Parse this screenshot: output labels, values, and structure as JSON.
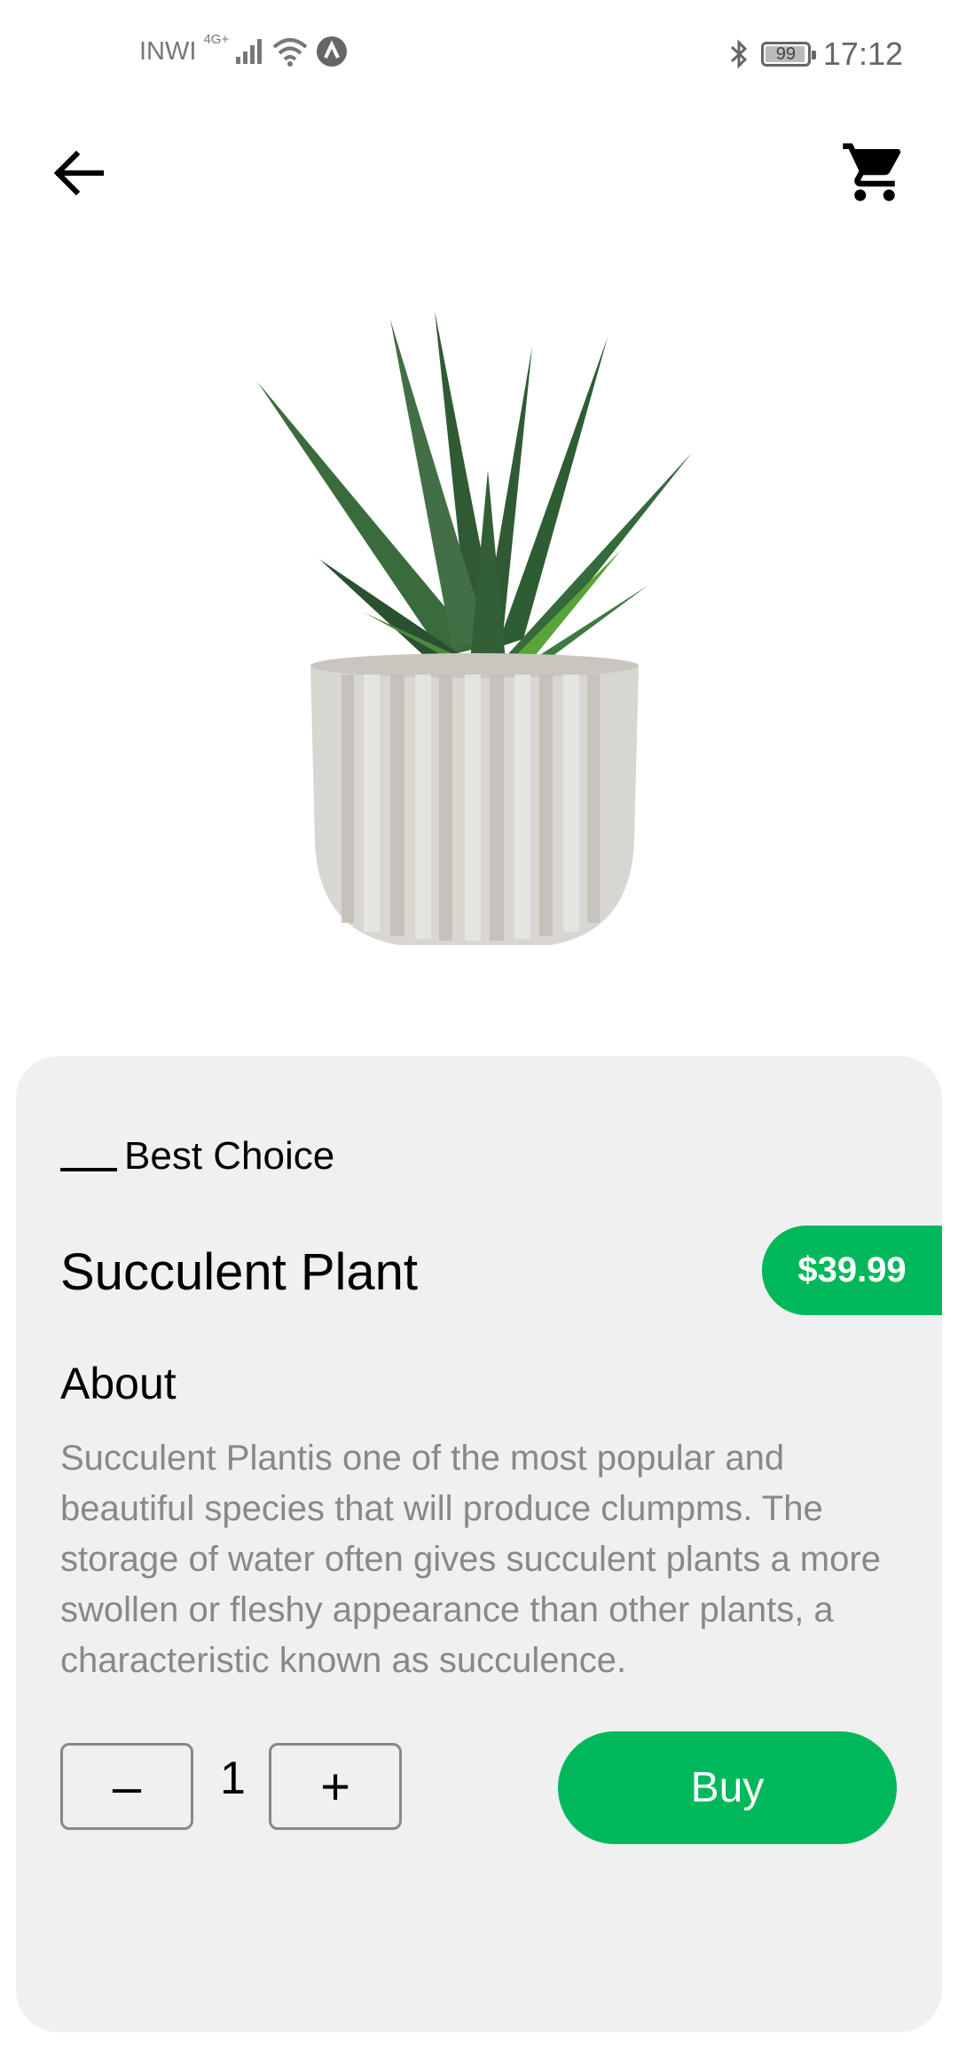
{
  "status_bar": {
    "carrier": "INWI",
    "network": "4G+",
    "battery": "99",
    "time": "17:12"
  },
  "product": {
    "tag": "Best Choice",
    "name": "Succulent Plant",
    "price": "$39.99",
    "about_heading": "About",
    "description": "Succulent Plantis one of the most popular and beautiful species that will produce clumpms. The storage of water often gives succulent plants a more swollen or fleshy appearance than other plants, a characteristic known as succulence."
  },
  "quantity": {
    "minus_label": "–",
    "value": "1",
    "plus_label": "+"
  },
  "actions": {
    "buy_label": "Buy"
  },
  "colors": {
    "accent": "#00b85c",
    "card_bg": "#f0f0f0"
  },
  "icons": [
    "back-arrow-icon",
    "cart-icon",
    "signal-icon",
    "wifi-icon",
    "bluetooth-icon",
    "battery-icon"
  ]
}
